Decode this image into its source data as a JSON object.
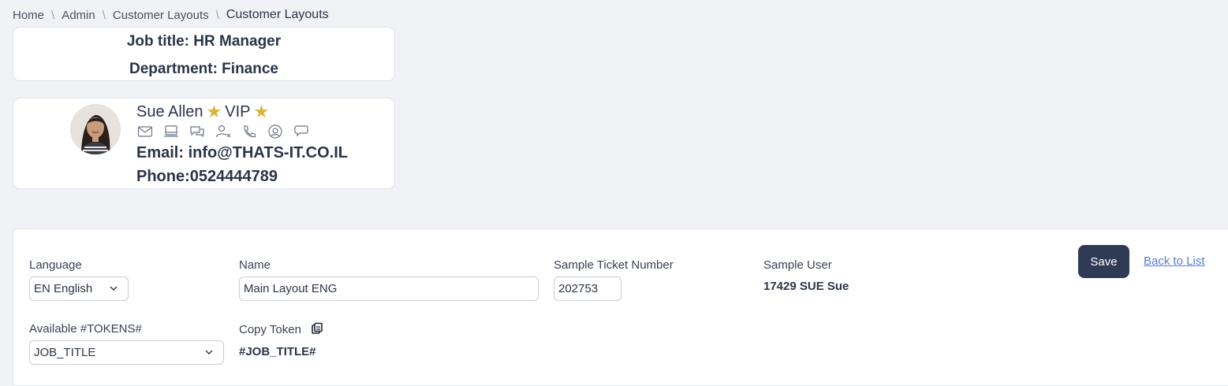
{
  "breadcrumb": {
    "items": [
      "Home",
      "Admin",
      "Customer Layouts"
    ],
    "current": "Customer Layouts"
  },
  "header_card": {
    "job_title": "Job title: HR Manager",
    "department": "Department: Finance"
  },
  "profile_card": {
    "name": "Sue Allen",
    "badge": "VIP",
    "email": "Email: info@THATS-IT.CO.IL",
    "phone": "Phone:0524444789",
    "action_icons": [
      "mail-icon",
      "laptop-icon",
      "chat-bubbles-icon",
      "user-remove-icon",
      "phone-icon",
      "at-sign-icon",
      "comment-icon"
    ]
  },
  "form": {
    "language_label": "Language",
    "language_value": "EN English",
    "name_label": "Name",
    "name_value": "Main Layout ENG",
    "ticket_label": "Sample Ticket Number",
    "ticket_value": "202753",
    "user_label": "Sample User",
    "user_value": "17429 SUE Sue",
    "tokens_label": "Available #TOKENS#",
    "tokens_value": "JOB_TITLE",
    "copy_token_label": "Copy Token",
    "copy_token_value": "#JOB_TITLE#",
    "save_label": "Save",
    "back_label": "Back to List"
  },
  "colors": {
    "background": "#f1f2f6",
    "primary_button": "#2f3a55",
    "link": "#5b7bd5",
    "star": "#d9b33a"
  }
}
